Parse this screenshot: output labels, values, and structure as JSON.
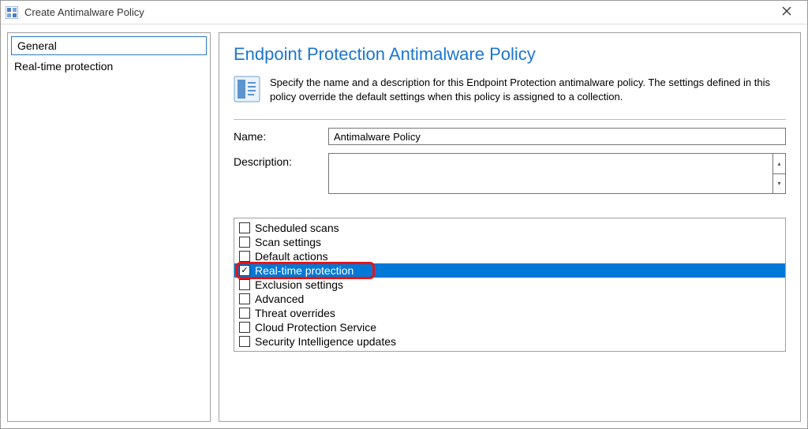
{
  "window": {
    "title": "Create Antimalware Policy"
  },
  "sidebar": {
    "items": [
      {
        "label": "General",
        "selected": true
      },
      {
        "label": "Real-time protection",
        "selected": false
      }
    ]
  },
  "main": {
    "heading": "Endpoint Protection Antimalware Policy",
    "intro": "Specify the name and a description for this Endpoint Protection antimalware policy. The settings defined in this policy override the default settings when this policy is assigned to a collection.",
    "name_label": "Name:",
    "name_value": "Antimalware Policy",
    "description_label": "Description:",
    "description_value": ""
  },
  "options": [
    {
      "label": "Scheduled scans",
      "checked": false,
      "selected": false
    },
    {
      "label": "Scan settings",
      "checked": false,
      "selected": false
    },
    {
      "label": "Default actions",
      "checked": false,
      "selected": false
    },
    {
      "label": "Real-time protection",
      "checked": true,
      "selected": true,
      "highlight": true
    },
    {
      "label": "Exclusion settings",
      "checked": false,
      "selected": false
    },
    {
      "label": "Advanced",
      "checked": false,
      "selected": false
    },
    {
      "label": "Threat overrides",
      "checked": false,
      "selected": false
    },
    {
      "label": "Cloud Protection Service",
      "checked": false,
      "selected": false
    },
    {
      "label": "Security Intelligence updates",
      "checked": false,
      "selected": false
    }
  ]
}
